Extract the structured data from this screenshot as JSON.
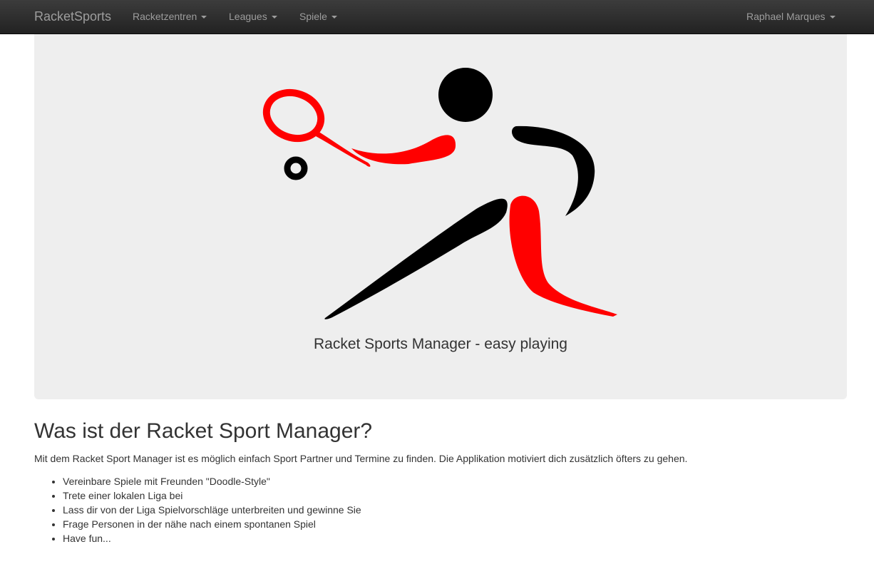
{
  "navbar": {
    "brand": "RacketSports",
    "menu": [
      {
        "label": "Racketzentren"
      },
      {
        "label": "Leagues"
      },
      {
        "label": "Spiele"
      }
    ],
    "user": "Raphael Marques"
  },
  "hero": {
    "tagline": "Racket Sports Manager - easy playing",
    "colors": {
      "red": "#ff0000",
      "black": "#000000",
      "background": "#eeeeee"
    }
  },
  "content": {
    "title": "Was ist der Racket Sport Manager?",
    "intro": "Mit dem Racket Sport Manager ist es möglich einfach Sport Partner und Termine zu finden. Die Applikation motiviert dich zusätzlich öfters zu gehen.",
    "features": [
      "Vereinbare Spiele mit Freunden \"Doodle-Style\"",
      "Trete einer lokalen Liga bei",
      "Lass dir von der Liga Spielvorschläge unterbreiten und gewinne Sie",
      "Frage Personen in der nähe nach einem spontanen Spiel",
      "Have fun..."
    ]
  }
}
